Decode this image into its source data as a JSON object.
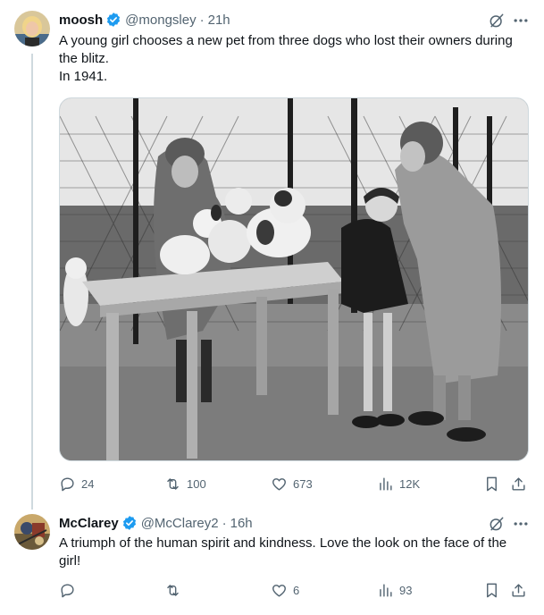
{
  "tweets": [
    {
      "author": {
        "name": "moosh",
        "handle": "@mongsley",
        "verified": true,
        "avatar": "avatar-blonde-woman"
      },
      "time": "21h",
      "text": [
        "A young girl chooses a new pet from three dogs who lost their owners during the blitz.",
        "In 1941."
      ],
      "media": "photo-girl-choosing-dog",
      "stats": {
        "replies": "24",
        "reposts": "100",
        "likes": "673",
        "views": "12K"
      }
    },
    {
      "author": {
        "name": "McClarey",
        "handle": "@McClarey2",
        "verified": true,
        "avatar": "avatar-painting"
      },
      "time": "16h",
      "text": [
        "A triumph of the human spirit and kindness.  Love the look on the face of the girl!"
      ],
      "stats": {
        "replies": "",
        "reposts": "",
        "likes": "6",
        "views": "93"
      }
    }
  ],
  "separator": "·",
  "colors": {
    "text": "#0f1419",
    "secondary": "#536471",
    "verified": "#1d9bf0",
    "border": "#cfd9de"
  }
}
